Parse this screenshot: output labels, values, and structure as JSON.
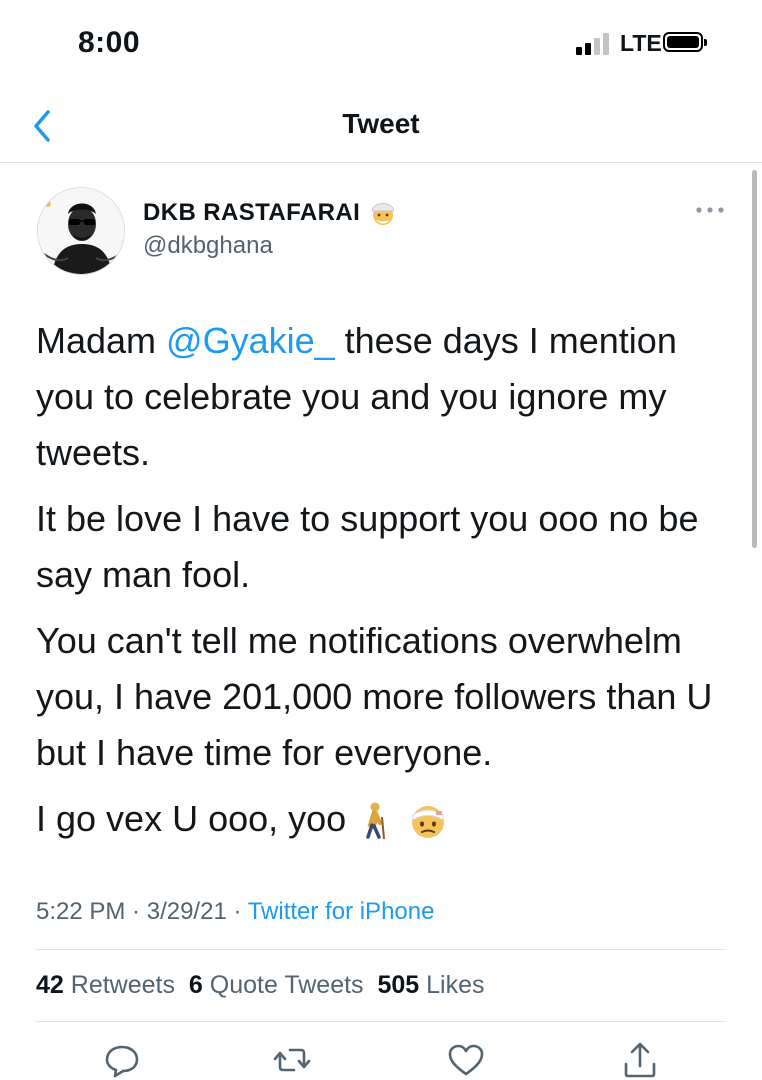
{
  "status_bar": {
    "time": "8:00",
    "network": "LTE"
  },
  "nav": {
    "title": "Tweet"
  },
  "tweet": {
    "author_name": "DKB RASTAFARAI",
    "author_handle": "@dkbghana",
    "paragraphs": [
      {
        "before": "Madam ",
        "mention": "@Gyakie_",
        "after": " these days I mention you to celebrate you and you ignore my tweets."
      },
      {
        "text": "It be love I have to support you ooo no be say man fool."
      },
      {
        "text": "You can't tell me notifications overwhelm you, I have 201,000 more followers than U but I have time for everyone."
      },
      {
        "text": "I go vex U ooo, yoo"
      }
    ],
    "time": "5:22 PM",
    "date": "3/29/21",
    "source": "Twitter for iPhone",
    "separator": " · "
  },
  "stats": {
    "retweets_count": "42",
    "retweets_label": "Retweets",
    "quotes_count": "6",
    "quotes_label": "Quote Tweets",
    "likes_count": "505",
    "likes_label": "Likes"
  },
  "icons": {
    "back": "chevron-left-icon",
    "more": "more-horizontal-icon",
    "reply": "comment-icon",
    "retweet": "retweet-icon",
    "like": "heart-icon",
    "share": "share-icon"
  },
  "colors": {
    "accent": "#1d9bf0",
    "secondary_text": "#536471",
    "primary_text": "#0f1419",
    "divider": "#e2e6ea"
  }
}
